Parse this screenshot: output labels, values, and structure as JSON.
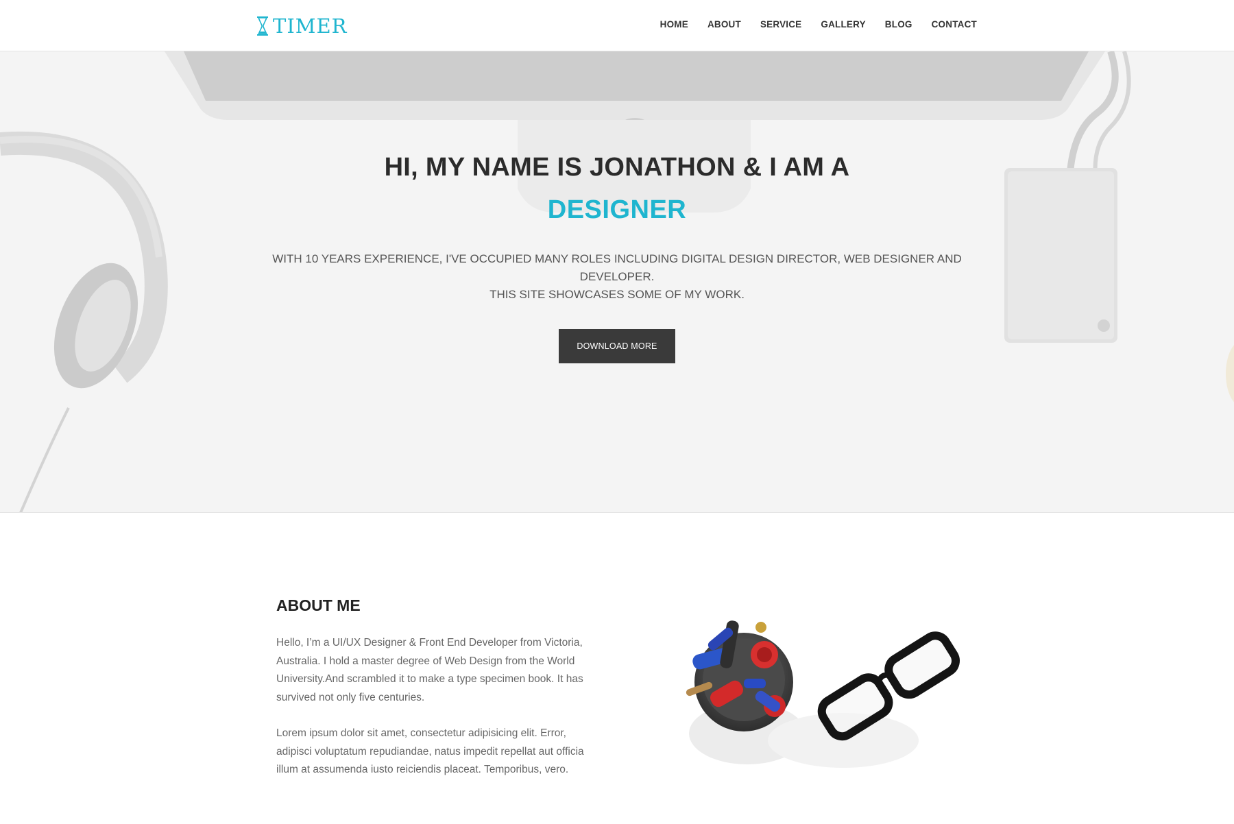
{
  "brand": {
    "name": "TIMER",
    "accent": "#1fb5cf",
    "icon": "hourglass-icon"
  },
  "nav": {
    "items": [
      {
        "label": "HOME"
      },
      {
        "label": "ABOUT"
      },
      {
        "label": "SERVICE"
      },
      {
        "label": "GALLERY"
      },
      {
        "label": "BLOG"
      },
      {
        "label": "CONTACT"
      }
    ]
  },
  "hero": {
    "title": "HI, MY NAME IS JONATHON & I AM A",
    "role": "DESIGNER",
    "description_line1": "WITH 10 YEARS EXPERIENCE, I'VE OCCUPIED MANY ROLES INCLUDING DIGITAL DESIGN DIRECTOR, WEB DESIGNER AND DEVELOPER.",
    "description_line2": "THIS SITE SHOWCASES SOME OF MY WORK.",
    "button_label": "DOWNLOAD MORE",
    "button_color": "#3a3a3a"
  },
  "about": {
    "title": "ABOUT ME",
    "paragraph1": "Hello, I’m a UI/UX Designer & Front End Developer from Victoria, Australia. I hold a master degree of Web Design from the World University.And scrambled it to make a type specimen book. It has survived not only five centuries.",
    "paragraph2": "Lorem ipsum dolor sit amet, consectetur adipisicing elit. Error, adipisci voluptatum repudiandae, natus impedit repellat aut officia illum at assumenda iusto reiciendis placeat. Temporibus, vero."
  }
}
